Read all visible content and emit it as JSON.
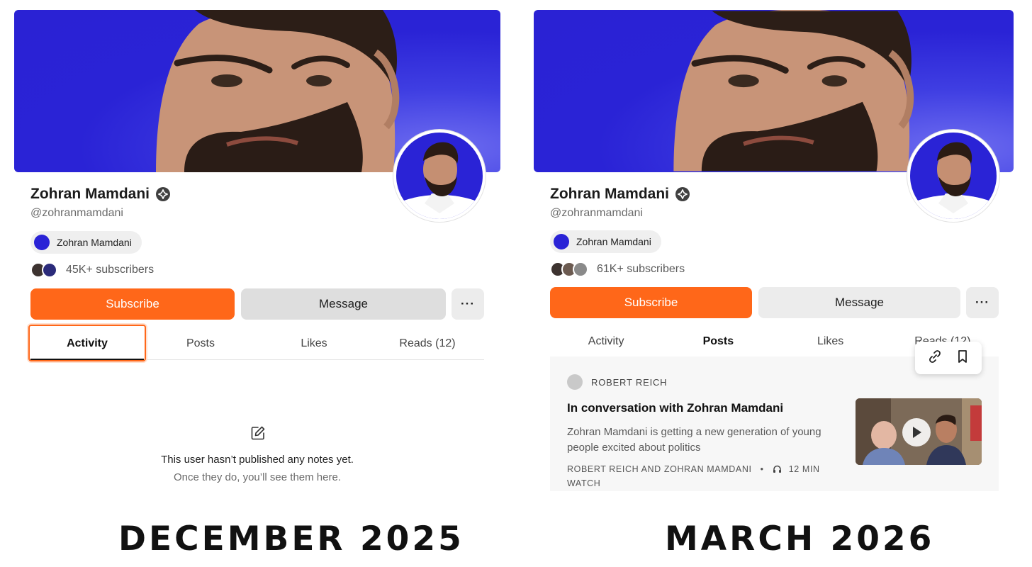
{
  "comparison": {
    "before": {
      "caption": "DECEMBER 2025",
      "profile": {
        "name": "Zohran Mamdani",
        "handle": "@zohranmamdani",
        "publication": "Zohran Mamdani",
        "subscribers": "45K+ subscribers"
      },
      "actions": {
        "subscribe": "Subscribe",
        "message": "Message",
        "more": "···"
      },
      "tabs": [
        {
          "label": "Activity",
          "active": true
        },
        {
          "label": "Posts",
          "active": false
        },
        {
          "label": "Likes",
          "active": false
        },
        {
          "label": "Reads (12)",
          "active": false
        }
      ],
      "empty_state": {
        "icon": "edit-icon",
        "line1": "This user hasn’t published any notes yet.",
        "line2": "Once they do, you’ll see them here."
      }
    },
    "after": {
      "caption": "MARCH 2026",
      "profile": {
        "name": "Zohran Mamdani",
        "handle": "@zohranmamdani",
        "publication": "Zohran Mamdani",
        "subscribers": "61K+ subscribers"
      },
      "actions": {
        "subscribe": "Subscribe",
        "message": "Message",
        "more": "···"
      },
      "tabs": [
        {
          "label": "Activity",
          "active": false
        },
        {
          "label": "Posts",
          "active": true
        },
        {
          "label": "Likes",
          "active": false
        },
        {
          "label": "Reads (12)",
          "active": false
        }
      ],
      "post": {
        "author": "ROBERT REICH",
        "title": "In conversation with Zohran Mamdani",
        "description": "Zohran Mamdani is getting a new generation of young people excited about politics",
        "byline": "ROBERT REICH AND ZOHRAN MAMDANI",
        "separator": "•",
        "duration": "12 MIN WATCH"
      },
      "tools": [
        "link-icon",
        "bookmark-icon"
      ]
    }
  },
  "colors": {
    "banner_blue": "#2a23d6",
    "accent_orange": "#ff6719",
    "message_gray": "#dedede",
    "text_dark": "#1b1b1b",
    "text_muted": "#6b6b6b"
  }
}
